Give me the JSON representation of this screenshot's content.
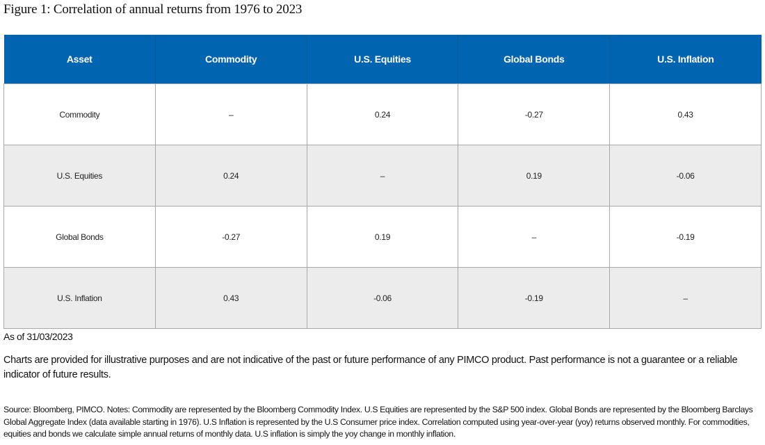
{
  "figure": {
    "title": "Figure 1: Correlation of annual returns from 1976 to 2023"
  },
  "table": {
    "headers": [
      "Asset",
      "Commodity",
      "U.S. Equities",
      "Global Bonds",
      "U.S. Inflation"
    ],
    "rows": [
      {
        "asset": "Commodity",
        "values": [
          "–",
          "0.24",
          "-0.27",
          "0.43"
        ]
      },
      {
        "asset": "U.S. Equities",
        "values": [
          "0.24",
          "–",
          "0.19",
          "-0.06"
        ]
      },
      {
        "asset": "Global Bonds",
        "values": [
          "-0.27",
          "0.19",
          "–",
          "-0.19"
        ]
      },
      {
        "asset": "U.S. Inflation",
        "values": [
          "0.43",
          "-0.06",
          "-0.19",
          "–"
        ]
      }
    ]
  },
  "colors": {
    "header_bg": "#0064b0",
    "header_text": "#ffffff",
    "alt_row_bg": "#ececec"
  },
  "notes": {
    "as_of": "As of 31/03/2023",
    "disclaimer": "Charts are provided for illustrative purposes and are not indicative of the past or future performance of any PIMCO product. Past performance is not a guarantee or a reliable indicator of future results.",
    "source": "Source: Bloomberg, PIMCO. Notes: Commodity are represented by the Bloomberg Commodity Index. U.S Equities are represented by the S&P 500 index. Global Bonds are represented by the Bloomberg Barclays Global Aggregate Index (data available starting in 1976). U.S Inflation is represented by the U.S Consumer price index. Correlation computed using year-over-year (yoy) returns observed monthly. For commodities, equities and bonds we calculate simple annual returns of monthly data. U.S inflation is simply the yoy change in monthly inflation."
  }
}
